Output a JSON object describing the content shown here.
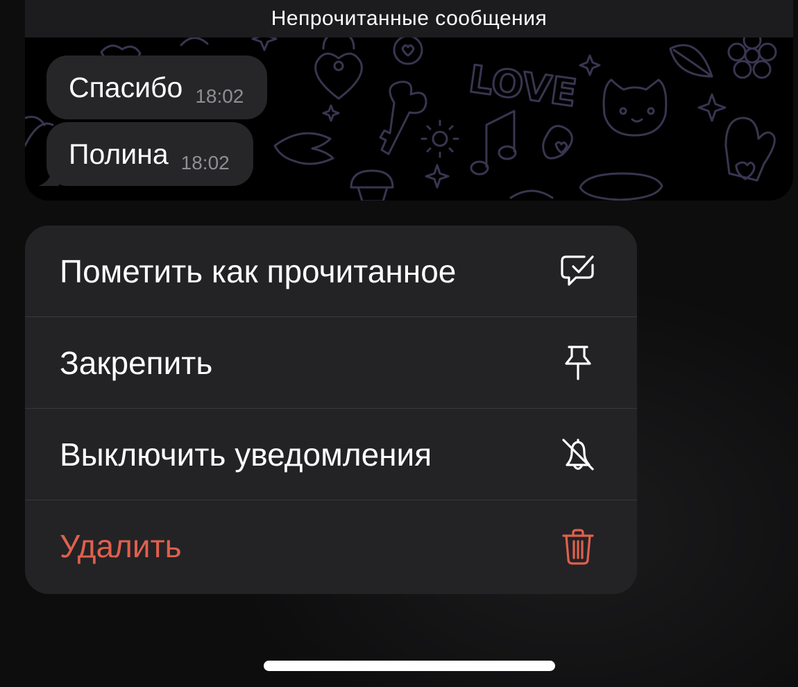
{
  "chat": {
    "banner": "Непрочитанные сообщения",
    "messages": [
      {
        "text": "Спасибо",
        "time": "18:02"
      },
      {
        "text": "Полина",
        "time": "18:02"
      }
    ]
  },
  "context_menu": {
    "items": [
      {
        "label": "Пометить как прочитанное",
        "icon": "mark-read-icon"
      },
      {
        "label": "Закрепить",
        "icon": "pin-icon"
      },
      {
        "label": "Выключить уведомления",
        "icon": "bell-off-icon"
      },
      {
        "label": "Удалить",
        "icon": "trash-icon",
        "destructive": true
      }
    ]
  },
  "colors": {
    "background": "#0d0d0e",
    "menu_background": "#232325",
    "bubble_background": "#262628",
    "destructive": "#e0604e",
    "doodle_stroke": "#3a3550"
  }
}
